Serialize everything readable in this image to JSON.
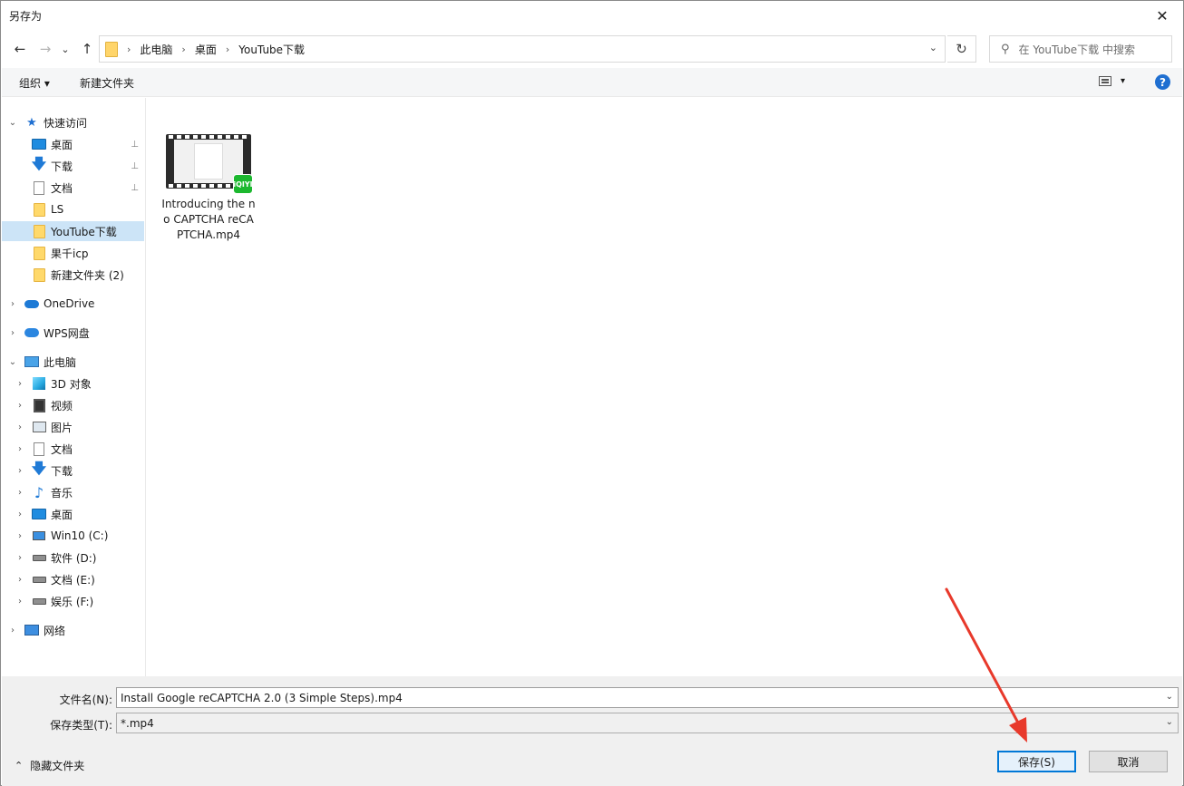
{
  "window": {
    "title": "另存为",
    "close_glyph": "✕"
  },
  "nav_buttons": {
    "back": "←",
    "forward": "→",
    "history": "⌄",
    "up": "↑"
  },
  "address": {
    "crumbs": [
      "此电脑",
      "桌面",
      "YouTube下载"
    ],
    "separator": "›",
    "dropdown": "⌄",
    "refresh": "↻"
  },
  "search": {
    "placeholder": "在 YouTube下载 中搜索",
    "icon": "⚲"
  },
  "toolbar": {
    "organize": "组织 ▾",
    "new_folder": "新建文件夹",
    "view_dropdown": "▾",
    "help": "?"
  },
  "nav": {
    "quick_access": "快速访问",
    "quick_items": [
      {
        "label": "桌面",
        "icon": "desktop-icon",
        "pinned": true
      },
      {
        "label": "下载",
        "icon": "download-icon",
        "pinned": true
      },
      {
        "label": "文档",
        "icon": "document-icon",
        "pinned": true
      },
      {
        "label": "LS",
        "icon": "folder-icon",
        "pinned": false
      },
      {
        "label": "YouTube下载",
        "icon": "folder-icon",
        "pinned": false
      },
      {
        "label": "果千icp",
        "icon": "folder-icon",
        "pinned": false
      },
      {
        "label": "新建文件夹 (2)",
        "icon": "folder-icon",
        "pinned": false
      }
    ],
    "onedrive": "OneDrive",
    "wps": "WPS网盘",
    "this_pc": "此电脑",
    "pc_items": [
      {
        "label": "3D 对象",
        "icon": "3d-objects-icon"
      },
      {
        "label": "视频",
        "icon": "video-icon"
      },
      {
        "label": "图片",
        "icon": "pictures-icon"
      },
      {
        "label": "文档",
        "icon": "document-icon"
      },
      {
        "label": "下载",
        "icon": "download-icon"
      },
      {
        "label": "音乐",
        "icon": "music-icon"
      },
      {
        "label": "桌面",
        "icon": "desktop-icon"
      },
      {
        "label": "Win10 (C:)",
        "icon": "system-drive-icon"
      },
      {
        "label": "软件 (D:)",
        "icon": "drive-icon"
      },
      {
        "label": "文档 (E:)",
        "icon": "drive-icon"
      },
      {
        "label": "娱乐 (F:)",
        "icon": "drive-icon"
      }
    ],
    "network": "网络",
    "chevron_right": "›",
    "chevron_down": "⌄",
    "pin_glyph": "📌"
  },
  "files": [
    {
      "name": "Introducing the no CAPTCHA reCAPTCHA.mp4",
      "badge": "iQIYI"
    }
  ],
  "bottom": {
    "filename_label": "文件名(N):",
    "filename_value": "Install Google reCAPTCHA 2.0 (3 Simple Steps).mp4",
    "filetype_label": "保存类型(T):",
    "filetype_value": "*.mp4",
    "dropdown": "⌄",
    "hide_folders": "隐藏文件夹",
    "hide_chevron": "⌃",
    "save": "保存(S)",
    "cancel": "取消"
  },
  "colors": {
    "accent": "#0078d7",
    "selection": "#cce4f7",
    "annotation_arrow": "#e8392b"
  }
}
